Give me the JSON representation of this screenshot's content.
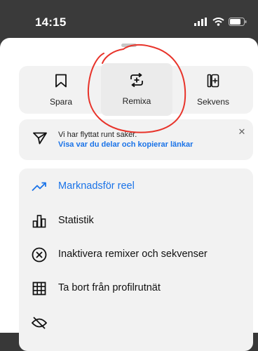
{
  "status_bar": {
    "time": "14:15"
  },
  "actions": [
    {
      "label": "Spara",
      "icon": "bookmark-icon"
    },
    {
      "label": "Remixa",
      "icon": "remix-icon"
    },
    {
      "label": "Sekvens",
      "icon": "sequence-icon"
    }
  ],
  "notice": {
    "title": "Vi har flyttat runt saker.",
    "link": "Visa var du delar och kopierar länkar",
    "close": "✕"
  },
  "menu": [
    {
      "label": "Marknadsför reel",
      "icon": "trending-up-icon",
      "accent": "#1a73e8"
    },
    {
      "label": "Statistik",
      "icon": "bar-chart-icon"
    },
    {
      "label": "Inaktivera remixer och sekvenser",
      "icon": "circle-x-icon"
    },
    {
      "label": "Ta bort från profilrutnät",
      "icon": "grid-icon"
    }
  ],
  "colors": {
    "accent": "#1a73e8",
    "annotation": "#e8332a"
  }
}
